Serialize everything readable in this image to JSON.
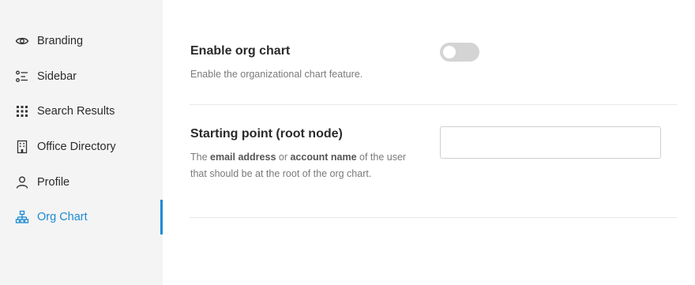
{
  "sidebar": {
    "items": [
      {
        "label": "Branding",
        "icon": "eye-icon"
      },
      {
        "label": "Sidebar",
        "icon": "list-icon"
      },
      {
        "label": "Search Results",
        "icon": "grid-icon"
      },
      {
        "label": "Office Directory",
        "icon": "building-icon"
      },
      {
        "label": "Profile",
        "icon": "person-icon"
      },
      {
        "label": "Org Chart",
        "icon": "org-chart-icon",
        "active": true
      }
    ],
    "accent_color": "#1b8ad3"
  },
  "settings": {
    "org_chart": {
      "title": "Enable org chart",
      "description": "Enable the organizational chart feature.",
      "enabled": false
    },
    "root_node": {
      "title": "Starting point (root node)",
      "desc_prefix": "The ",
      "desc_bold1": "email address",
      "desc_mid": " or ",
      "desc_bold2": "account name",
      "desc_suffix": " of the user that should be at the root of the org chart.",
      "value": "",
      "placeholder": ""
    }
  }
}
